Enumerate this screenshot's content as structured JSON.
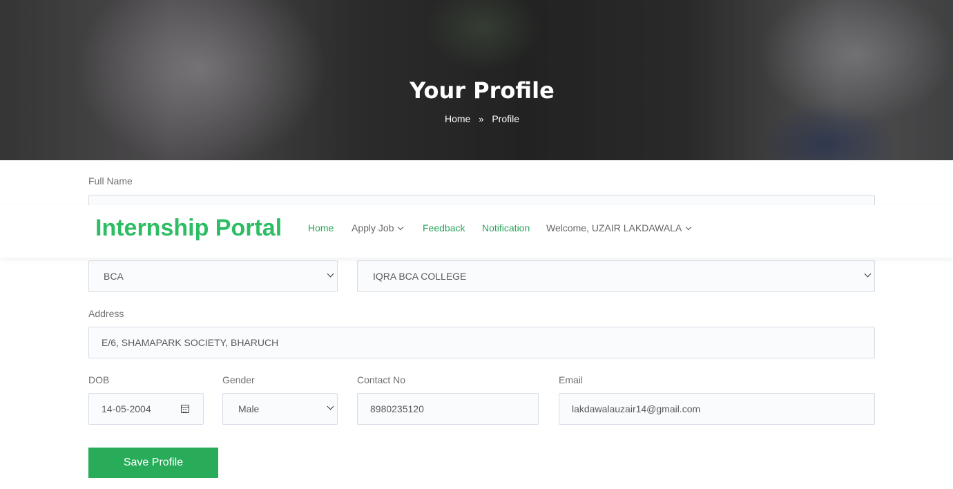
{
  "hero": {
    "title": "Your Profile",
    "breadcrumb": {
      "home": "Home",
      "separator": "»",
      "current": "Profile"
    }
  },
  "navbar": {
    "brand": "Internship Portal",
    "items": [
      {
        "label": "Home"
      },
      {
        "label": "Apply Job"
      },
      {
        "label": "Feedback"
      },
      {
        "label": "Notification"
      },
      {
        "label": "Welcome, UZAIR LAKDAWALA"
      }
    ]
  },
  "form": {
    "full_name_label": "Full Name",
    "full_name_value": "",
    "course_value": "BCA",
    "college_value": "IQRA BCA COLLEGE",
    "address_label": "Address",
    "address_value": "E/6, SHAMAPARK SOCIETY, BHARUCH",
    "dob_label": "DOB",
    "dob_value": "14-05-2004",
    "gender_label": "Gender",
    "gender_value": "Male",
    "contact_label": "Contact No",
    "contact_value": "8980235120",
    "email_label": "Email",
    "email_value": "lakdawalauzair14@gmail.com",
    "save_label": "Save Profile"
  },
  "colors": {
    "brand": "#2dbd62",
    "nav_active": "#2aa35a",
    "button": "#28ac5a"
  },
  "icons": [
    "calendar-icon",
    "chevron-down-icon",
    "double-chevron-right-icon"
  ]
}
